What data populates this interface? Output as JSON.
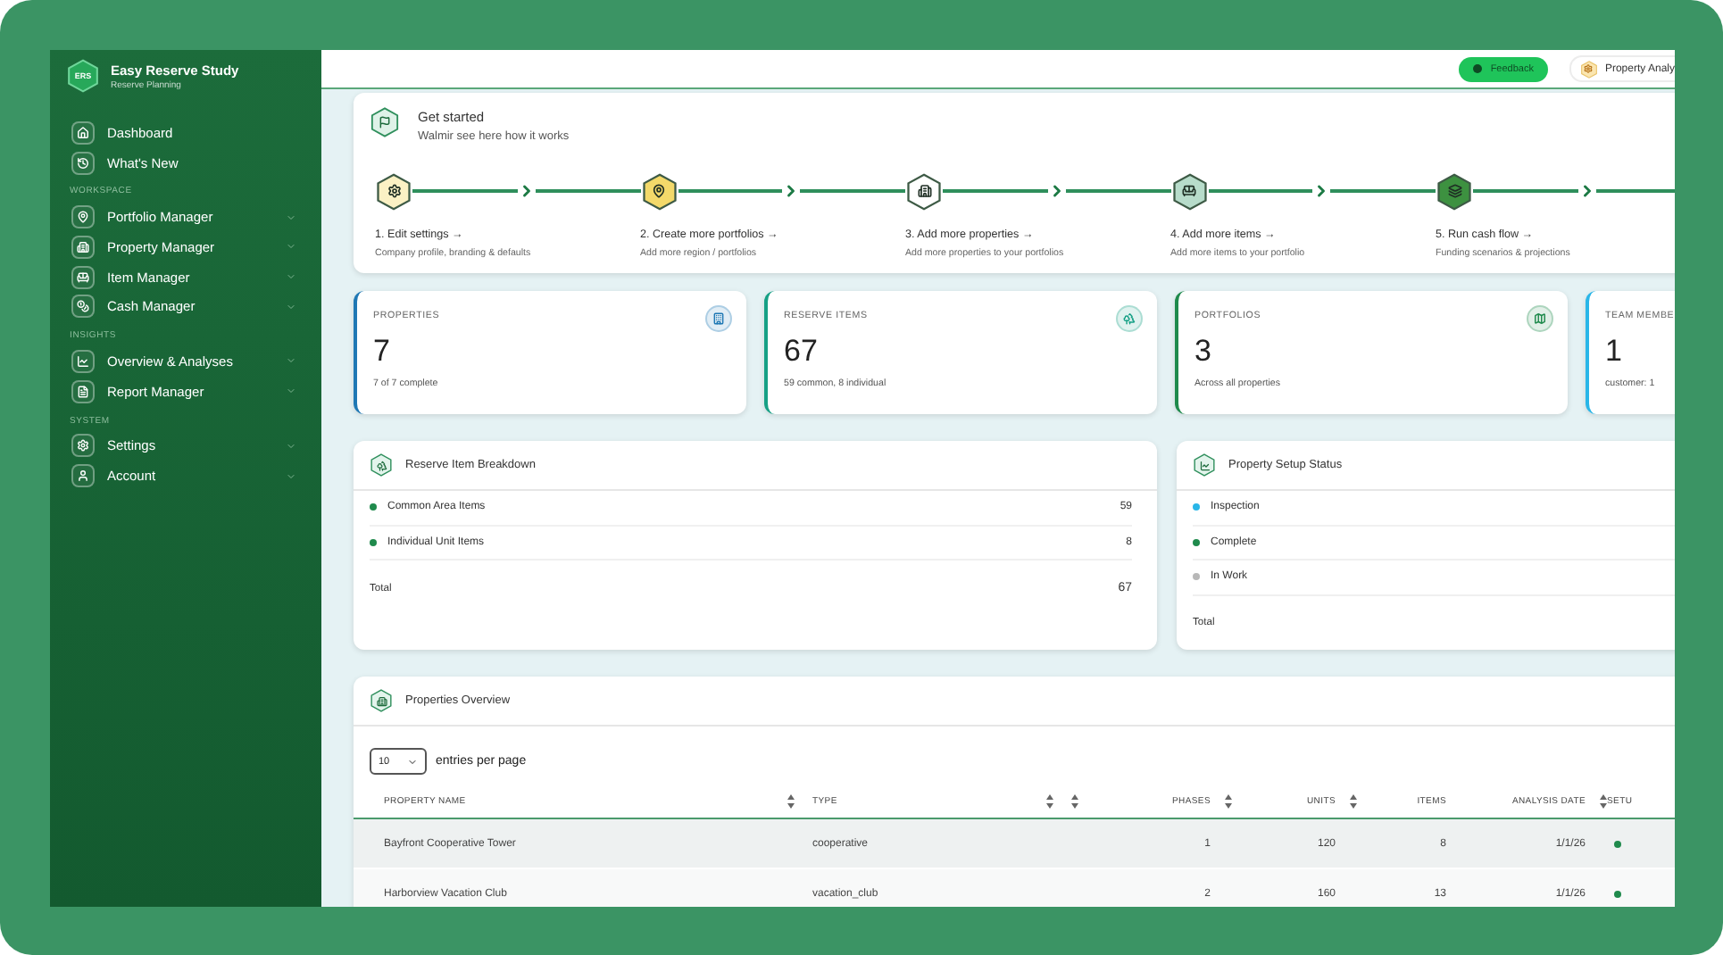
{
  "brand": {
    "logo_text": "ERS",
    "title": "Easy Reserve Study",
    "subtitle": "Reserve Planning"
  },
  "sidebar": {
    "sections": [
      {
        "items": [
          {
            "label": "Dashboard",
            "has_submenu": false
          },
          {
            "label": "What's New",
            "has_submenu": false
          }
        ]
      },
      {
        "label": "WORKSPACE",
        "items": [
          {
            "label": "Portfolio Manager",
            "has_submenu": true
          },
          {
            "label": "Property Manager",
            "has_submenu": true
          },
          {
            "label": "Item Manager",
            "has_submenu": true
          },
          {
            "label": "Cash Manager",
            "has_submenu": true
          }
        ]
      },
      {
        "label": "INSIGHTS",
        "items": [
          {
            "label": "Overview & Analyses",
            "has_submenu": true
          },
          {
            "label": "Report Manager",
            "has_submenu": true
          }
        ]
      },
      {
        "label": "SYSTEM",
        "items": [
          {
            "label": "Settings",
            "has_submenu": true
          },
          {
            "label": "Account",
            "has_submenu": true
          }
        ]
      }
    ]
  },
  "topbar": {
    "feedback": "Feedback",
    "property_button": "Property Analy"
  },
  "get_started": {
    "title": "Get started",
    "subtitle": "Walmir see here how it works",
    "steps": [
      {
        "label": "1. Edit settings →",
        "description": "Company profile, branding & defaults",
        "color": "#fbf1c4"
      },
      {
        "label": "2. Create more portfolios →",
        "description": "Add more region / portfolios",
        "color": "#f3d96a"
      },
      {
        "label": "3. Add more properties →",
        "description": "Add more properties to your portfolios",
        "color": "#ffffff"
      },
      {
        "label": "4. Add more items →",
        "description": "Add more items to your portfolio",
        "color": "#b7dcca"
      },
      {
        "label": "5. Run cash flow →",
        "description": "Funding scenarios & projections",
        "color": "#3d9140"
      }
    ]
  },
  "stats": [
    {
      "label": "PROPERTIES",
      "value": "7",
      "note": "7 of 7 complete",
      "color": "#1f78b4"
    },
    {
      "label": "RESERVE ITEMS",
      "value": "67",
      "note": "59 common, 8 individual",
      "color": "#16a085"
    },
    {
      "label": "PORTFOLIOS",
      "value": "3",
      "note": "Across all properties",
      "color": "#1f8a4c"
    },
    {
      "label": "TEAM MEMBE",
      "value": "1",
      "note": "customer: 1",
      "color": "#29b6e8"
    }
  ],
  "breakdown": {
    "title": "Reserve Item Breakdown",
    "rows": [
      {
        "label": "Common Area Items",
        "value": "59",
        "color": "#1f8a4c"
      },
      {
        "label": "Individual Unit Items",
        "value": "8",
        "color": "#1f8a4c"
      }
    ],
    "total_label": "Total",
    "total_value": "67"
  },
  "setup_status": {
    "title": "Property Setup Status",
    "rows": [
      {
        "label": "Inspection",
        "color": "#29b6e8"
      },
      {
        "label": "Complete",
        "color": "#1f8a4c"
      },
      {
        "label": "In Work",
        "color": "#b8b8b8"
      }
    ],
    "total_label": "Total"
  },
  "properties": {
    "title": "Properties Overview",
    "page_size": "10",
    "entries_label": "entries per page",
    "columns": [
      {
        "label": "PROPERTY NAME",
        "sortable": true
      },
      {
        "label": "TYPE",
        "sortable": true
      },
      {
        "sortable": true
      },
      {
        "label": "PHASES",
        "sortable": true
      },
      {
        "label": "UNITS",
        "sortable": true
      },
      {
        "label": "ITEMS",
        "sortable": false
      },
      {
        "label": "ANALYSIS DATE",
        "sortable": true
      },
      {
        "label": "SETU",
        "sortable": false
      }
    ],
    "rows": [
      {
        "name": "Bayfront Cooperative Tower",
        "type": "cooperative",
        "phases": "1",
        "units": "120",
        "items": "8",
        "analysis_date": "1/1/26"
      },
      {
        "name": "Harborview Vacation Club",
        "type": "vacation_club",
        "phases": "2",
        "units": "160",
        "items": "13",
        "analysis_date": "1/1/26"
      }
    ]
  }
}
